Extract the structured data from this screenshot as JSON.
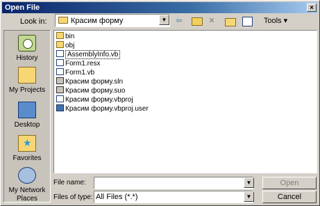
{
  "window": {
    "title": "Open File",
    "close_glyph": "×"
  },
  "lookin": {
    "label": "Look in:",
    "folder": "Красим форму"
  },
  "toolbar": {
    "back_glyph": "⇦",
    "delete_glyph": "✕",
    "tools_label": "Tools ▾"
  },
  "places": [
    {
      "label": "History",
      "icon": "history-icon"
    },
    {
      "label": "My Projects",
      "icon": "folder-projects-icon"
    },
    {
      "label": "Desktop",
      "icon": "desktop-icon"
    },
    {
      "label": "Favorites",
      "icon": "favorites-icon"
    },
    {
      "label": "My Network Places",
      "icon": "network-places-icon"
    }
  ],
  "files": [
    {
      "name": "bin",
      "type": "folder"
    },
    {
      "name": "obj",
      "type": "folder"
    },
    {
      "name": "AssemblyInfo.vb",
      "type": "vb"
    },
    {
      "name": "Form1.resx",
      "type": "vb"
    },
    {
      "name": "Form1.vb",
      "type": "vb"
    },
    {
      "name": "Красим форму.sln",
      "type": "sln"
    },
    {
      "name": "Красим форму.suo",
      "type": "sln"
    },
    {
      "name": "Красим форму.vbproj",
      "type": "vb"
    },
    {
      "name": "Красим форму.vbproj.user",
      "type": "user"
    }
  ],
  "filename": {
    "label": "File name:",
    "value": ""
  },
  "filetype": {
    "label": "Files of type:",
    "value": "All Files (*.*)"
  },
  "buttons": {
    "open": "Open",
    "cancel": "Cancel"
  }
}
